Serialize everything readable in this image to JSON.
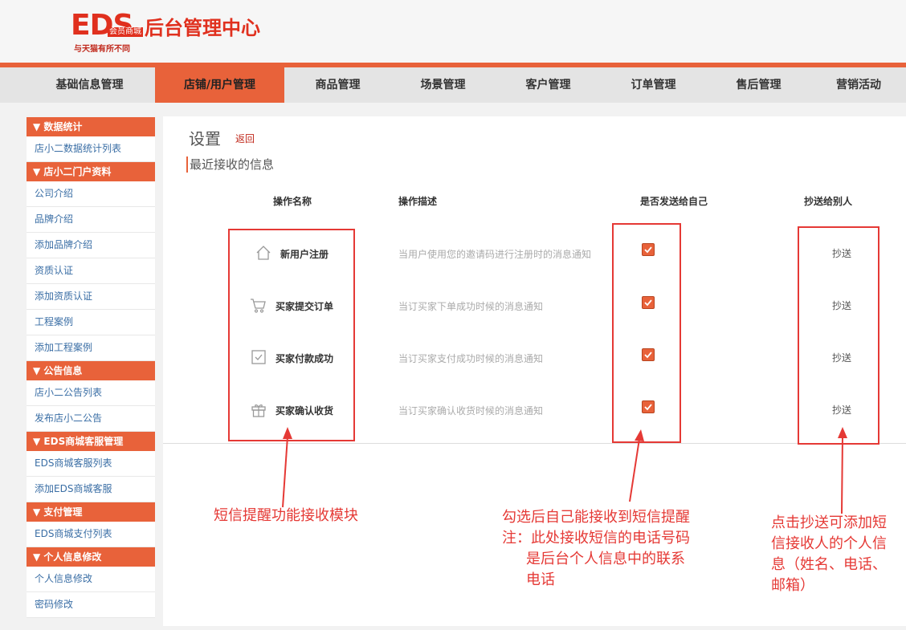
{
  "logo": {
    "mark": "EDS",
    "sub": "会员商城",
    "title": "后台管理中心",
    "slogan": "与天猫有所不同"
  },
  "nav": {
    "items": [
      {
        "label": "基础信息管理"
      },
      {
        "label": "店铺/用户管理"
      },
      {
        "label": "商品管理"
      },
      {
        "label": "场景管理"
      },
      {
        "label": "客户管理"
      },
      {
        "label": "订单管理"
      },
      {
        "label": "售后管理"
      },
      {
        "label": "营销活动"
      }
    ],
    "active_index": 1
  },
  "sidebar": {
    "groups": [
      {
        "title": "▼ 数据统计",
        "items": [
          "店小二数据统计列表"
        ]
      },
      {
        "title": "▼ 店小二门户资料",
        "items": [
          "公司介绍",
          "品牌介绍",
          "添加品牌介绍",
          "资质认证",
          "添加资质认证",
          "工程案例",
          "添加工程案例"
        ]
      },
      {
        "title": "▼ 公告信息",
        "items": [
          "店小二公告列表",
          "发布店小二公告"
        ]
      },
      {
        "title": "▼ EDS商城客服管理",
        "items": [
          "EDS商城客服列表",
          "添加EDS商城客服"
        ]
      },
      {
        "title": "▼ 支付管理",
        "items": [
          "EDS商城支付列表"
        ]
      },
      {
        "title": "▼ 个人信息修改",
        "items": [
          "个人信息修改",
          "密码修改"
        ]
      }
    ]
  },
  "main": {
    "title": "设置",
    "back_label": "返回",
    "section_title": "最近接收的信息",
    "columns": {
      "name": "操作名称",
      "desc": "操作描述",
      "self": "是否发送给自己",
      "cc": "抄送给别人"
    },
    "rows": [
      {
        "icon": "home-icon",
        "name": "新用户注册",
        "desc": "当用户使用您的邀请码进行注册时的消息通知",
        "checked": true,
        "cc": "抄送"
      },
      {
        "icon": "cart-icon",
        "name": "买家提交订单",
        "desc": "当订买家下单成功时候的消息通知",
        "checked": true,
        "cc": "抄送"
      },
      {
        "icon": "check-square-icon",
        "name": "买家付款成功",
        "desc": "当订买家支付成功时候的消息通知",
        "checked": true,
        "cc": "抄送"
      },
      {
        "icon": "gift-icon",
        "name": "买家确认收货",
        "desc": "当订买家确认收货时候的消息通知",
        "checked": true,
        "cc": "抄送"
      }
    ]
  },
  "annotations": {
    "module": "短信提醒功能接收模块",
    "self_line1": "勾选后自己能接收到短信提醒",
    "self_line2": "注：此处接收短信的电话号码",
    "self_line3": "是后台个人信息中的联系",
    "self_line4": "电话",
    "cc_line1": "点击抄送可添加短",
    "cc_line2": "信接收人的个人信",
    "cc_line3": "息（姓名、电话、",
    "cc_line4": "邮箱）",
    "color": "#e53935"
  },
  "colors": {
    "accent": "#e8623a",
    "link": "#3a6ea5",
    "brand": "#e0301e"
  }
}
